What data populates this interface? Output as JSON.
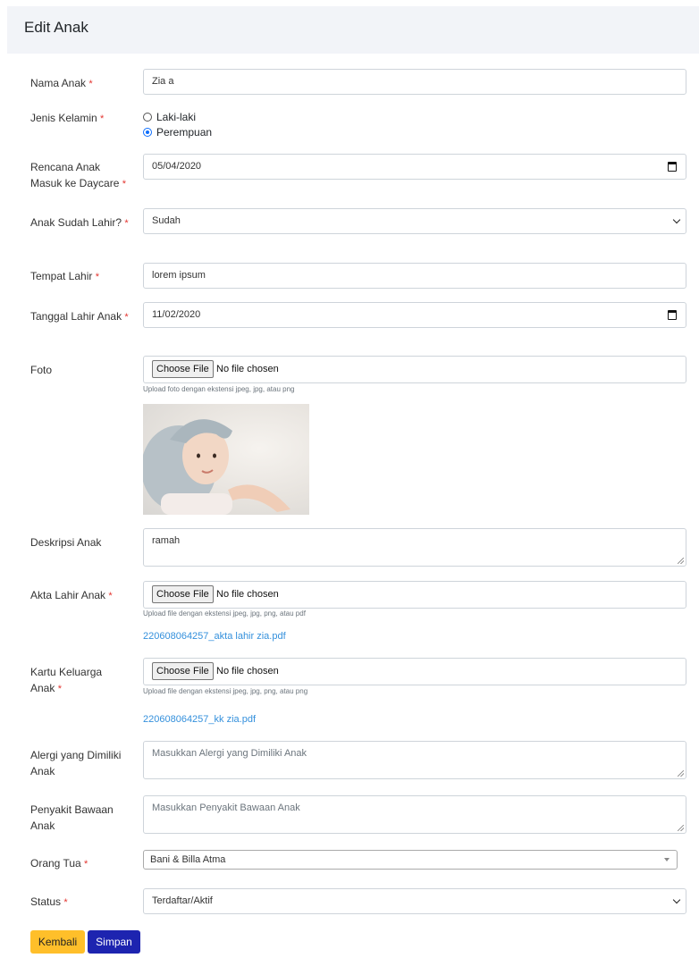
{
  "page": {
    "title": "Edit Anak"
  },
  "fields": {
    "nama_anak": {
      "label": "Nama Anak",
      "value": "Zia a"
    },
    "jenis_kelamin": {
      "label": "Jenis Kelamin",
      "options": [
        "Laki-laki",
        "Perempuan"
      ],
      "selected": "Perempuan"
    },
    "rencana_masuk": {
      "label_line1": "Rencana Anak",
      "label_line2": "Masuk ke Daycare",
      "value": "05/04/2020"
    },
    "sudah_lahir": {
      "label": "Anak Sudah Lahir?",
      "value": "Sudah"
    },
    "tempat_lahir": {
      "label": "Tempat Lahir",
      "value": "lorem ipsum"
    },
    "tanggal_lahir": {
      "label": "Tanggal Lahir Anak",
      "value": "11/02/2020"
    },
    "foto": {
      "label": "Foto",
      "button": "Choose File",
      "status": "No file chosen",
      "help": "Upload foto dengan ekstensi jpeg, jpg, atau png"
    },
    "deskripsi": {
      "label": "Deskripsi Anak",
      "value": "ramah"
    },
    "akta": {
      "label": "Akta Lahir Anak",
      "button": "Choose File",
      "status": "No file chosen",
      "help": "Upload file dengan ekstensi jpeg, jpg, png, atau pdf",
      "link": "220608064257_akta lahir zia.pdf"
    },
    "kk": {
      "label_line1": "Kartu Keluarga",
      "label_line2": "Anak",
      "button": "Choose File",
      "status": "No file chosen",
      "help": "Upload file dengan ekstensi jpeg, jpg, png, atau png",
      "link": "220608064257_kk zia.pdf"
    },
    "alergi": {
      "label_line1": "Alergi yang Dimiliki",
      "label_line2": "Anak",
      "placeholder": "Masukkan Alergi yang Dimiliki Anak"
    },
    "penyakit": {
      "label_line1": "Penyakit Bawaan",
      "label_line2": "Anak",
      "placeholder": "Masukkan Penyakit Bawaan Anak"
    },
    "orang_tua": {
      "label": "Orang Tua",
      "value": "Bani & Billa Atma"
    },
    "status": {
      "label": "Status",
      "value": "Terdaftar/Aktif"
    }
  },
  "required_marker": "*",
  "buttons": {
    "back": "Kembali",
    "save": "Simpan"
  },
  "colors": {
    "required": "#e3342f",
    "link": "#3490dc",
    "back_button": "#ffbf2a",
    "save_button": "#1d24b0",
    "radio_checked": "#0d6efd"
  }
}
